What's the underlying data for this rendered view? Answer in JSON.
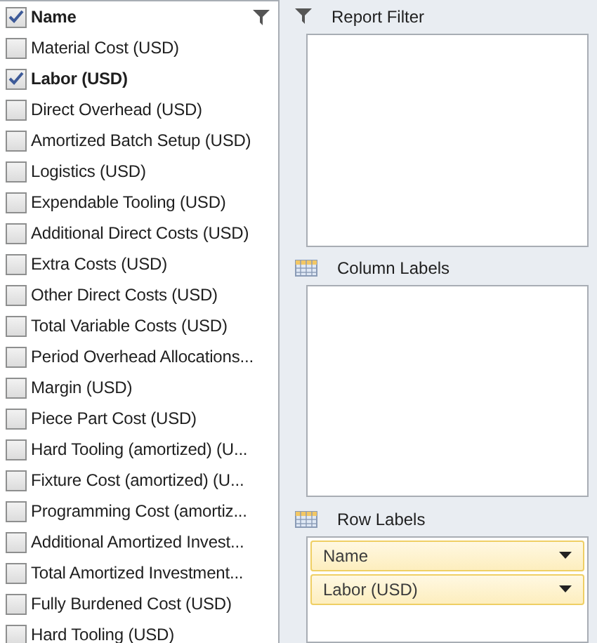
{
  "field_list": [
    {
      "label": "Name",
      "checked": true,
      "filtered": true
    },
    {
      "label": "Material Cost (USD)",
      "checked": false,
      "filtered": false
    },
    {
      "label": "Labor (USD)",
      "checked": true,
      "filtered": false
    },
    {
      "label": "Direct Overhead (USD)",
      "checked": false,
      "filtered": false
    },
    {
      "label": "Amortized Batch Setup (USD)",
      "checked": false,
      "filtered": false
    },
    {
      "label": "Logistics (USD)",
      "checked": false,
      "filtered": false
    },
    {
      "label": "Expendable Tooling (USD)",
      "checked": false,
      "filtered": false
    },
    {
      "label": "Additional Direct Costs (USD)",
      "checked": false,
      "filtered": false
    },
    {
      "label": "Extra Costs (USD)",
      "checked": false,
      "filtered": false
    },
    {
      "label": "Other Direct Costs (USD)",
      "checked": false,
      "filtered": false
    },
    {
      "label": "Total Variable Costs (USD)",
      "checked": false,
      "filtered": false
    },
    {
      "label": "Period Overhead Allocations...",
      "checked": false,
      "filtered": false
    },
    {
      "label": "Margin (USD)",
      "checked": false,
      "filtered": false
    },
    {
      "label": "Piece Part Cost (USD)",
      "checked": false,
      "filtered": false
    },
    {
      "label": "Hard Tooling (amortized) (U...",
      "checked": false,
      "filtered": false
    },
    {
      "label": "Fixture Cost (amortized) (U...",
      "checked": false,
      "filtered": false
    },
    {
      "label": "Programming Cost (amortiz...",
      "checked": false,
      "filtered": false
    },
    {
      "label": "Additional Amortized Invest...",
      "checked": false,
      "filtered": false
    },
    {
      "label": "Total Amortized Investment...",
      "checked": false,
      "filtered": false
    },
    {
      "label": "Fully Burdened Cost (USD)",
      "checked": false,
      "filtered": false
    },
    {
      "label": "Hard Tooling (USD)",
      "checked": false,
      "filtered": false
    }
  ],
  "areas": [
    {
      "kind": "filter",
      "title": "Report Filter"
    },
    {
      "kind": "columns",
      "title": "Column Labels"
    },
    {
      "kind": "rows",
      "title": "Row Labels",
      "items": [
        "Name",
        "Labor (USD)"
      ]
    }
  ]
}
